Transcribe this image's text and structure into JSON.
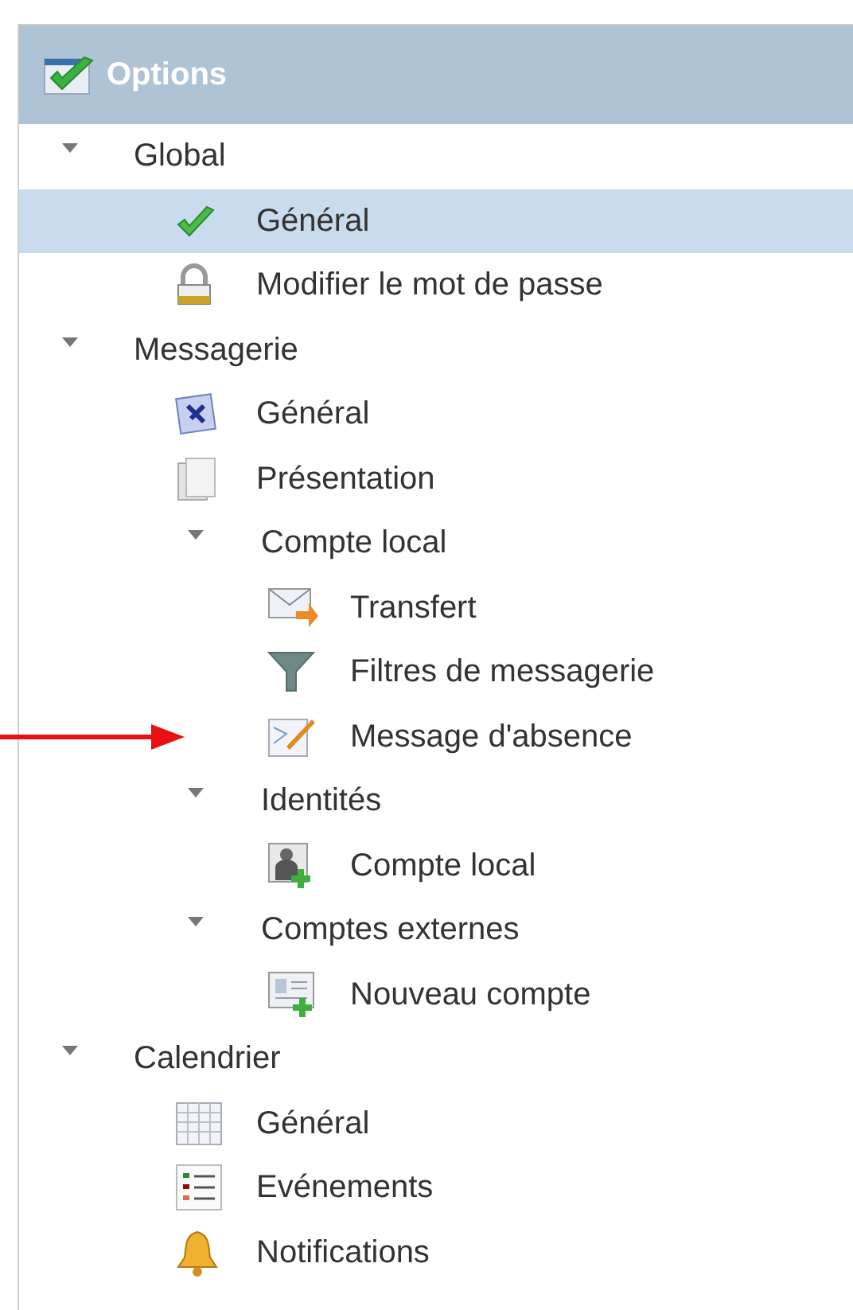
{
  "panel": {
    "title": "Options"
  },
  "tree": [
    {
      "kind": "group",
      "label": "Global",
      "expanded": true,
      "children": [
        {
          "kind": "leaf",
          "label": "Général",
          "selected": true,
          "marked": false
        },
        {
          "kind": "leaf",
          "label": "Modifier le mot de passe",
          "selected": false,
          "marked": false
        }
      ]
    },
    {
      "kind": "group",
      "label": "Messagerie",
      "expanded": true,
      "children": [
        {
          "kind": "leaf",
          "label": "Général",
          "selected": false,
          "marked": false
        },
        {
          "kind": "leaf",
          "label": "Présentation",
          "selected": false,
          "marked": false
        },
        {
          "kind": "group",
          "label": "Compte local",
          "expanded": true,
          "children": [
            {
              "kind": "leaf",
              "label": "Transfert",
              "selected": false,
              "marked": false
            },
            {
              "kind": "leaf",
              "label": "Filtres de messagerie",
              "selected": false,
              "marked": false
            },
            {
              "kind": "leaf",
              "label": "Message d'absence",
              "selected": false,
              "marked": true
            }
          ]
        },
        {
          "kind": "group",
          "label": "Identités",
          "expanded": true,
          "children": [
            {
              "kind": "leaf",
              "label": "Compte local",
              "selected": false,
              "marked": false
            }
          ]
        },
        {
          "kind": "group",
          "label": "Comptes externes",
          "expanded": true,
          "children": [
            {
              "kind": "leaf",
              "label": "Nouveau compte",
              "selected": false,
              "marked": false
            }
          ]
        }
      ]
    },
    {
      "kind": "group",
      "label": "Calendrier",
      "expanded": true,
      "children": [
        {
          "kind": "leaf",
          "label": "Général",
          "selected": false,
          "marked": false
        },
        {
          "kind": "leaf",
          "label": "Evénements",
          "selected": false,
          "marked": false
        },
        {
          "kind": "leaf",
          "label": "Notifications",
          "selected": false,
          "marked": false
        }
      ]
    }
  ]
}
